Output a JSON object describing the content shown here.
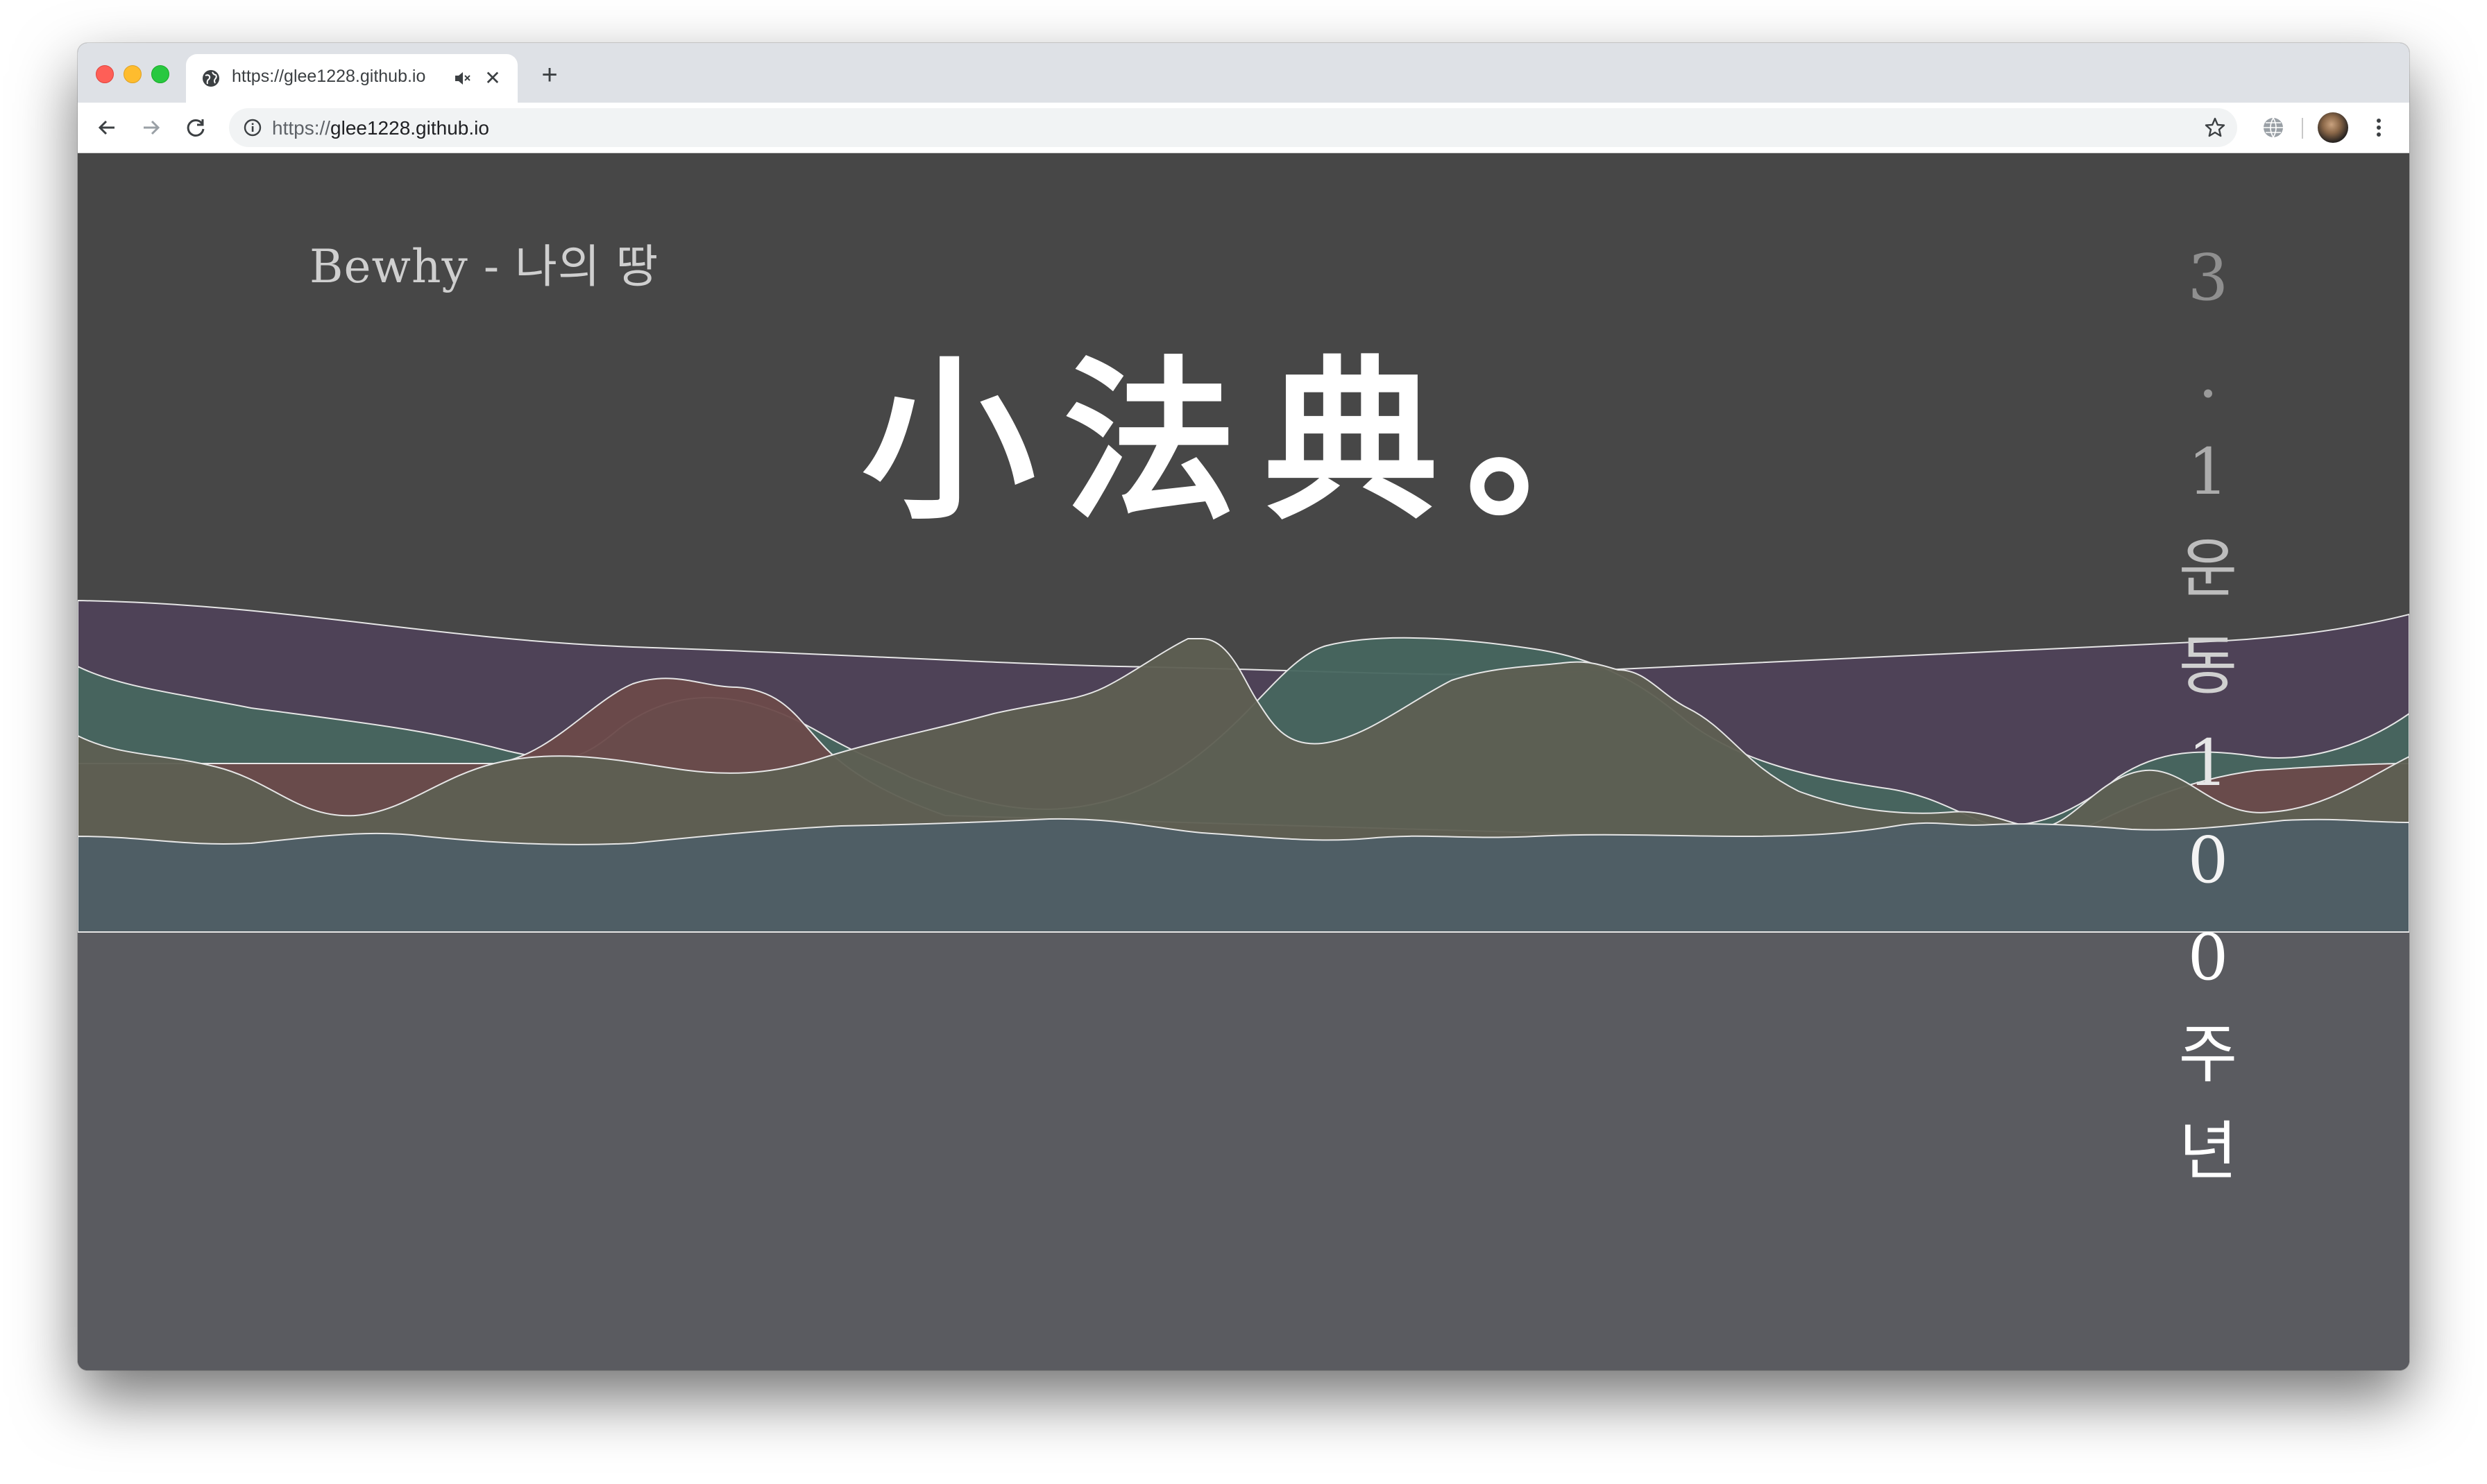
{
  "browser": {
    "tab": {
      "title": "https://glee1228.github.io",
      "favicon_icon": "globe-icon",
      "audio_icon": "speaker-muted-icon",
      "close_icon": "close-icon"
    },
    "new_tab_icon": "plus-icon",
    "toolbar": {
      "back_icon": "arrow-left-icon",
      "forward_icon": "arrow-right-icon",
      "reload_icon": "reload-icon",
      "site_info_icon": "info-icon",
      "url_scheme": "https://",
      "url_host": "glee1228.github.io",
      "bookmark_icon": "star-icon",
      "extension_icon": "globe-icon",
      "profile_icon": "avatar",
      "menu_icon": "kebab-menu-icon"
    }
  },
  "page": {
    "song_title": "Bewhy - 나의 땅",
    "headline": "小法典。",
    "vertical_text": [
      "3",
      ".",
      "1",
      "운",
      "동",
      "1",
      "0",
      "0",
      "주",
      "년"
    ],
    "colors": {
      "background_top": "#474747",
      "background_bottom": "#5a5b60",
      "wave_purple": "#4f4258",
      "wave_teal": "#47665f",
      "wave_red": "#6c4a4a",
      "wave_olive": "#5e5f52",
      "wave_slate": "#4f5e66"
    }
  }
}
